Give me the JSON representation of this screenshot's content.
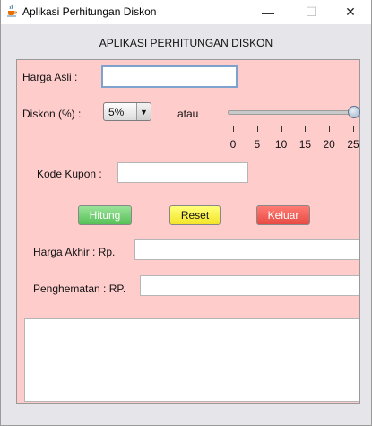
{
  "window": {
    "title": "Aplikasi Perhitungan Diskon",
    "minimize_glyph": "—",
    "maximize_glyph": "☐",
    "close_glyph": "✕"
  },
  "header": {
    "title": "APLIKASI PERHITUNGAN DISKON"
  },
  "form": {
    "harga_asli": {
      "label": "Harga Asli :",
      "value": ""
    },
    "diskon": {
      "label": "Diskon (%) :",
      "selected": "5%",
      "or_label": "atau"
    },
    "slider": {
      "ticks": [
        "0",
        "5",
        "10",
        "15",
        "20",
        "25"
      ],
      "min": 0,
      "max": 25,
      "value": 25
    },
    "kode_kupon": {
      "label": "Kode Kupon :",
      "value": ""
    },
    "buttons": {
      "hitung": "Hitung",
      "reset": "Reset",
      "keluar": "Keluar"
    },
    "harga_akhir": {
      "label": "Harga Akhir : Rp.",
      "value": ""
    },
    "penghematan": {
      "label": "Penghematan : RP.",
      "value": ""
    },
    "output": {
      "value": ""
    }
  },
  "colors": {
    "panel": "#ffcccc",
    "hitung": "#57c157",
    "reset": "#f4e42a",
    "keluar": "#e74b43"
  },
  "icons": {
    "app": "java-cup-icon"
  }
}
